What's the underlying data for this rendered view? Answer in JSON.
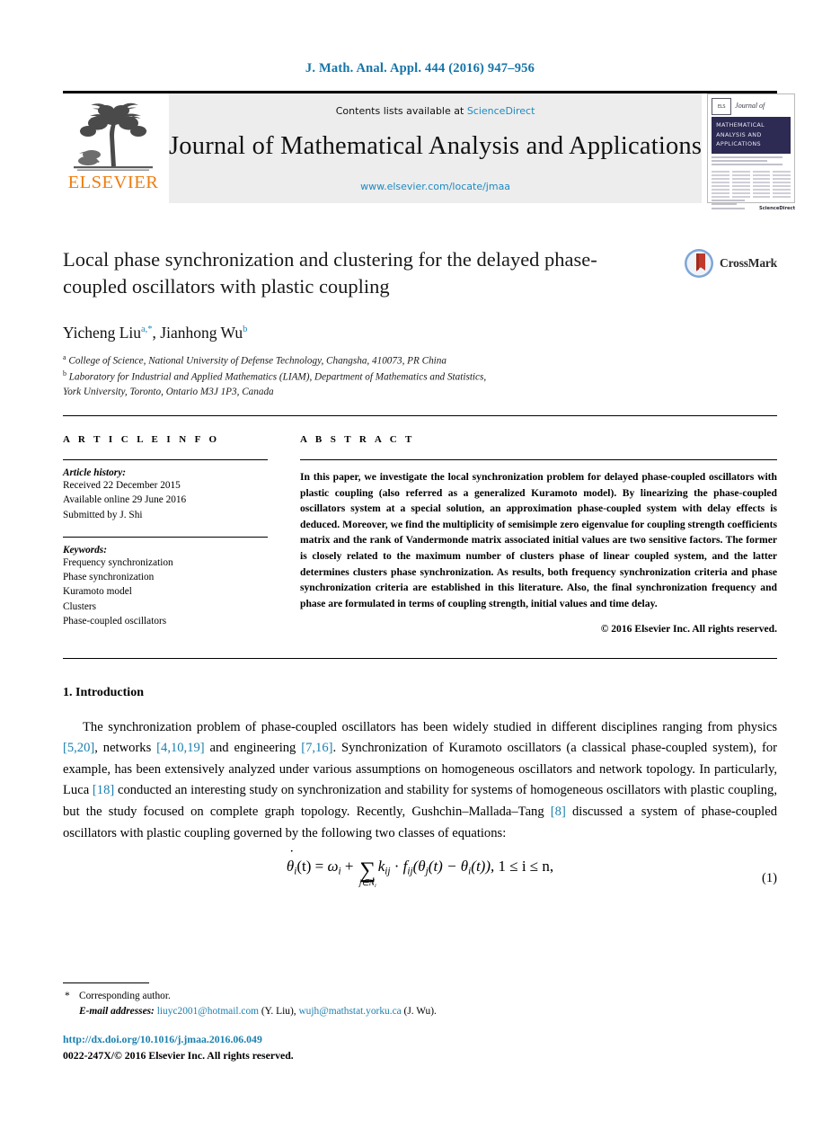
{
  "running_head": "J. Math. Anal. Appl. 444 (2016) 947–956",
  "masthead": {
    "contents_prefix": "Contents lists available at ",
    "sciencedirect": "ScienceDirect",
    "journal_title": "Journal of Mathematical Analysis and Applications",
    "journal_url": "www.elsevier.com/locate/jmaa",
    "publisher_logo_text": "ELSEVIER",
    "cover": {
      "journal_of": "Journal of",
      "band_line1": "MATHEMATICAL",
      "band_line2": "ANALYSIS AND",
      "band_line3": "APPLICATIONS",
      "sciencedirect_mark": "ScienceDirect"
    }
  },
  "article": {
    "title": "Local phase synchronization and clustering for the delayed phase-coupled oscillators with plastic coupling",
    "crossmark_label": "CrossMark",
    "authors": "Yicheng Liu",
    "author1_sup": "a,*",
    "authors_second": ", Jianhong Wu",
    "author2_sup": "b",
    "affiliation_a_sup": "a",
    "affiliation_a": "College of Science, National University of Defense Technology, Changsha, 410073, PR China",
    "affiliation_b_sup": "b",
    "affiliation_b_line1": "Laboratory for Industrial and Applied Mathematics (LIAM), Department of Mathematics and Statistics,",
    "affiliation_b_line2": "York University, Toronto, Ontario M3J 1P3, Canada"
  },
  "info": {
    "section_label": "A R T I C L E   I N F O",
    "history_head": "Article history:",
    "history": [
      "Received 22 December 2015",
      "Available online 29 June 2016",
      "Submitted by J. Shi"
    ],
    "keywords_head": "Keywords:",
    "keywords": [
      "Frequency synchronization",
      "Phase synchronization",
      "Kuramoto model",
      "Clusters",
      "Phase-coupled oscillators"
    ]
  },
  "abstract": {
    "section_label": "A B S T R A C T",
    "text": "In this paper, we investigate the local synchronization problem for delayed phase-coupled oscillators with plastic coupling (also referred as a generalized Kuramoto model). By linearizing the phase-coupled oscillators system at a special solution, an approximation phase-coupled system with delay effects is deduced. Moreover, we find the multiplicity of semisimple zero eigenvalue for coupling strength coefficients matrix and the rank of Vandermonde matrix associated initial values are two sensitive factors. The former is closely related to the maximum number of clusters phase of linear coupled system, and the latter determines clusters phase synchronization. As results, both frequency synchronization criteria and phase synchronization criteria are established in this literature. Also, the final synchronization frequency and phase are formulated in terms of coupling strength, initial values and time delay.",
    "copyright": "© 2016 Elsevier Inc. All rights reserved."
  },
  "body": {
    "section_number_title": "1. Introduction",
    "paragraph1_part1": "The synchronization problem of phase-coupled oscillators has been widely studied in different disciplines ranging from physics ",
    "cite1": "[5,20]",
    "paragraph1_part2": ", networks ",
    "cite2": "[4,10,19]",
    "paragraph1_part3": " and engineering ",
    "cite3": "[7,16]",
    "paragraph1_part4": ". Synchronization of Kuramoto oscillators (a classical phase-coupled system), for example, has been extensively analyzed under various assumptions on homogeneous oscillators and network topology. In particularly, Luca ",
    "cite4": "[18]",
    "paragraph1_part5": " conducted an interesting study on synchronization and stability for systems of homogeneous oscillators with plastic coupling, but the study focused on complete graph topology. Recently, Gushchin–Mallada–Tang ",
    "cite5": "[8]",
    "paragraph1_part6": " discussed a system of phase-coupled oscillators with plastic coupling governed by the following two classes of equations:"
  },
  "equation1": {
    "lhs_theta": "θ",
    "lhs_sub": "i",
    "lhs_arg": "(t) = ",
    "omega": "ω",
    "omega_sub": "i",
    "plus": " + ",
    "sum_glyph": "∑",
    "sum_sub": "j∈N",
    "sum_sub_i": "i",
    "k_sym": "k",
    "k_sub": "ij",
    "dot": " · ",
    "f_sym": "f",
    "f_sub": "ij",
    "inner": "(θ",
    "inner_sub_j": "j",
    "inner_mid": "(t) − θ",
    "inner_sub_i": "i",
    "inner_end": "(t)), ",
    "range": "1 ≤ i ≤ n,",
    "number": "(1)"
  },
  "footnotes": {
    "corresponding_marker": "*",
    "corresponding_text": "Corresponding author.",
    "email_label": "E-mail addresses:",
    "email1": "liuyc2001@hotmail.com",
    "email1_owner": " (Y. Liu), ",
    "email2": "wujh@mathstat.yorku.ca",
    "email2_owner": " (J. Wu).",
    "doi": "http://dx.doi.org/10.1016/j.jmaa.2016.06.049",
    "issn_line": "0022-247X/© 2016 Elsevier Inc. All rights reserved."
  },
  "colors": {
    "link_blue": "#1b7fae",
    "sciencedirect_blue": "#1f8ac0",
    "elsevier_orange": "#ee7d11",
    "cover_navy": "#2d2a53",
    "band_grey": "#ededed"
  }
}
